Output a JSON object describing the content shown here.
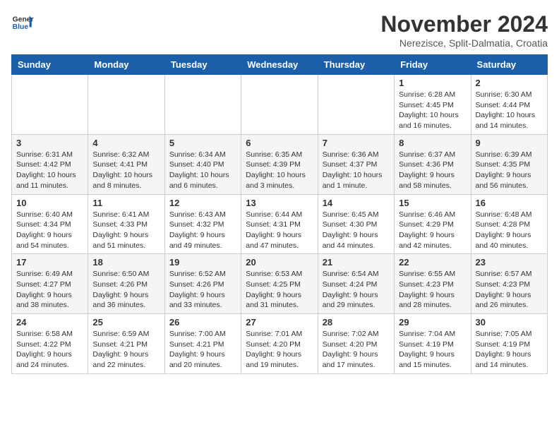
{
  "logo": {
    "general": "General",
    "blue": "Blue"
  },
  "header": {
    "month_title": "November 2024",
    "location": "Nerezisce, Split-Dalmatia, Croatia"
  },
  "weekdays": [
    "Sunday",
    "Monday",
    "Tuesday",
    "Wednesday",
    "Thursday",
    "Friday",
    "Saturday"
  ],
  "weeks": [
    [
      {
        "day": "",
        "info": ""
      },
      {
        "day": "",
        "info": ""
      },
      {
        "day": "",
        "info": ""
      },
      {
        "day": "",
        "info": ""
      },
      {
        "day": "",
        "info": ""
      },
      {
        "day": "1",
        "info": "Sunrise: 6:28 AM\nSunset: 4:45 PM\nDaylight: 10 hours and 16 minutes."
      },
      {
        "day": "2",
        "info": "Sunrise: 6:30 AM\nSunset: 4:44 PM\nDaylight: 10 hours and 14 minutes."
      }
    ],
    [
      {
        "day": "3",
        "info": "Sunrise: 6:31 AM\nSunset: 4:42 PM\nDaylight: 10 hours and 11 minutes."
      },
      {
        "day": "4",
        "info": "Sunrise: 6:32 AM\nSunset: 4:41 PM\nDaylight: 10 hours and 8 minutes."
      },
      {
        "day": "5",
        "info": "Sunrise: 6:34 AM\nSunset: 4:40 PM\nDaylight: 10 hours and 6 minutes."
      },
      {
        "day": "6",
        "info": "Sunrise: 6:35 AM\nSunset: 4:39 PM\nDaylight: 10 hours and 3 minutes."
      },
      {
        "day": "7",
        "info": "Sunrise: 6:36 AM\nSunset: 4:37 PM\nDaylight: 10 hours and 1 minute."
      },
      {
        "day": "8",
        "info": "Sunrise: 6:37 AM\nSunset: 4:36 PM\nDaylight: 9 hours and 58 minutes."
      },
      {
        "day": "9",
        "info": "Sunrise: 6:39 AM\nSunset: 4:35 PM\nDaylight: 9 hours and 56 minutes."
      }
    ],
    [
      {
        "day": "10",
        "info": "Sunrise: 6:40 AM\nSunset: 4:34 PM\nDaylight: 9 hours and 54 minutes."
      },
      {
        "day": "11",
        "info": "Sunrise: 6:41 AM\nSunset: 4:33 PM\nDaylight: 9 hours and 51 minutes."
      },
      {
        "day": "12",
        "info": "Sunrise: 6:43 AM\nSunset: 4:32 PM\nDaylight: 9 hours and 49 minutes."
      },
      {
        "day": "13",
        "info": "Sunrise: 6:44 AM\nSunset: 4:31 PM\nDaylight: 9 hours and 47 minutes."
      },
      {
        "day": "14",
        "info": "Sunrise: 6:45 AM\nSunset: 4:30 PM\nDaylight: 9 hours and 44 minutes."
      },
      {
        "day": "15",
        "info": "Sunrise: 6:46 AM\nSunset: 4:29 PM\nDaylight: 9 hours and 42 minutes."
      },
      {
        "day": "16",
        "info": "Sunrise: 6:48 AM\nSunset: 4:28 PM\nDaylight: 9 hours and 40 minutes."
      }
    ],
    [
      {
        "day": "17",
        "info": "Sunrise: 6:49 AM\nSunset: 4:27 PM\nDaylight: 9 hours and 38 minutes."
      },
      {
        "day": "18",
        "info": "Sunrise: 6:50 AM\nSunset: 4:26 PM\nDaylight: 9 hours and 36 minutes."
      },
      {
        "day": "19",
        "info": "Sunrise: 6:52 AM\nSunset: 4:26 PM\nDaylight: 9 hours and 33 minutes."
      },
      {
        "day": "20",
        "info": "Sunrise: 6:53 AM\nSunset: 4:25 PM\nDaylight: 9 hours and 31 minutes."
      },
      {
        "day": "21",
        "info": "Sunrise: 6:54 AM\nSunset: 4:24 PM\nDaylight: 9 hours and 29 minutes."
      },
      {
        "day": "22",
        "info": "Sunrise: 6:55 AM\nSunset: 4:23 PM\nDaylight: 9 hours and 28 minutes."
      },
      {
        "day": "23",
        "info": "Sunrise: 6:57 AM\nSunset: 4:23 PM\nDaylight: 9 hours and 26 minutes."
      }
    ],
    [
      {
        "day": "24",
        "info": "Sunrise: 6:58 AM\nSunset: 4:22 PM\nDaylight: 9 hours and 24 minutes."
      },
      {
        "day": "25",
        "info": "Sunrise: 6:59 AM\nSunset: 4:21 PM\nDaylight: 9 hours and 22 minutes."
      },
      {
        "day": "26",
        "info": "Sunrise: 7:00 AM\nSunset: 4:21 PM\nDaylight: 9 hours and 20 minutes."
      },
      {
        "day": "27",
        "info": "Sunrise: 7:01 AM\nSunset: 4:20 PM\nDaylight: 9 hours and 19 minutes."
      },
      {
        "day": "28",
        "info": "Sunrise: 7:02 AM\nSunset: 4:20 PM\nDaylight: 9 hours and 17 minutes."
      },
      {
        "day": "29",
        "info": "Sunrise: 7:04 AM\nSunset: 4:19 PM\nDaylight: 9 hours and 15 minutes."
      },
      {
        "day": "30",
        "info": "Sunrise: 7:05 AM\nSunset: 4:19 PM\nDaylight: 9 hours and 14 minutes."
      }
    ]
  ]
}
